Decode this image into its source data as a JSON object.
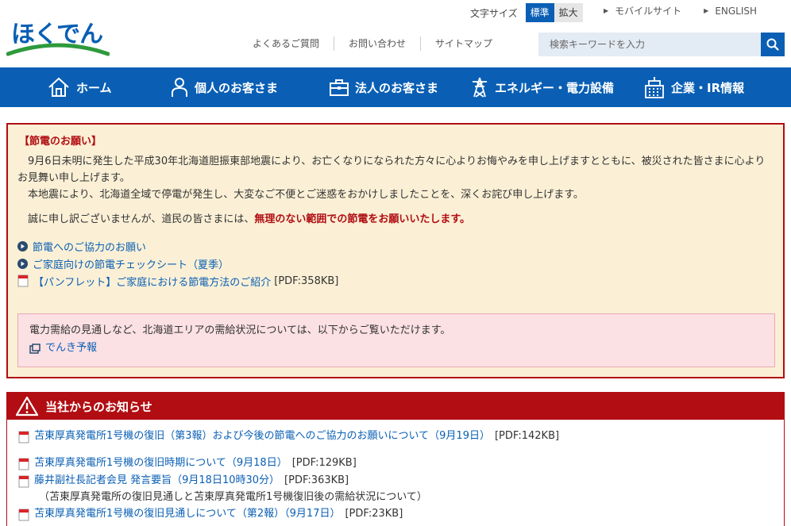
{
  "header": {
    "logo_text": "ほくでん",
    "font_size_label": "文字サイズ",
    "font_size_standard": "標準",
    "font_size_large": "拡大",
    "mobile_link": "モバイルサイト",
    "english_link": "ENGLISH",
    "faq": "よくあるご質問",
    "contact": "お問い合わせ",
    "sitemap": "サイトマップ",
    "search_placeholder": "検索キーワードを入力"
  },
  "nav": {
    "home": "ホーム",
    "personal": "個人のお客さま",
    "business": "法人のお客さま",
    "energy": "エネルギー・電力設備",
    "corporate": "企業・IR情報"
  },
  "notice": {
    "title": "【節電のお願い】",
    "para1": "9月6日未明に発生した平成30年北海道胆振東部地震により、お亡くなりになられた方々に心よりお悔やみを申し上げますとともに、被災された皆さまに心よりお見舞い申し上げます。",
    "para2": "本地震により、北海道全域で停電が発生し、大変なご不便とご迷惑をおかけしましたことを、深くお詫び申し上げます。",
    "para3_prefix": "誠に申し訳ございませんが、道民の皆さまには、",
    "para3_strong": "無理のない範囲での節電をお願いいたします。",
    "link1": "節電へのご協力のお願い",
    "link2": "ご家庭向けの節電チェックシート（夏季）",
    "link3": "【パンフレット】ご家庭における節電方法のご紹介",
    "link3_suffix": "[PDF:358KB]",
    "supply_text": "電力需給の見通しなど、北海道エリアの需給状況については、以下からご覧いただけます。",
    "supply_link": "でんき予報"
  },
  "news": {
    "title": "当社からのお知らせ",
    "items": [
      {
        "text": "苫東厚真発電所1号機の復旧（第3報）および今後の節電へのご協力のお願いについて（9月19日）",
        "suffix": "[PDF:142KB]"
      },
      {
        "text": "苫東厚真発電所1号機の復旧時期について（9月18日）",
        "suffix": "[PDF:129KB]"
      },
      {
        "text": "藤井副社長記者会見 発言要旨（9月18日10時30分）",
        "suffix": "[PDF:363KB]",
        "sub": "（苫東厚真発電所の復旧見通しと苫東厚真発電所1号機復旧後の需給状況について）"
      },
      {
        "text": "苫東厚真発電所1号機の復旧見通しについて（第2報）（9月17日）",
        "suffix": "[PDF:23KB]"
      }
    ]
  },
  "colors": {
    "brand_blue": "#0a5fb4",
    "alert_red": "#b10d12",
    "notice_bg": "#fbf0d6",
    "pink_bg": "#fbe0e4"
  }
}
